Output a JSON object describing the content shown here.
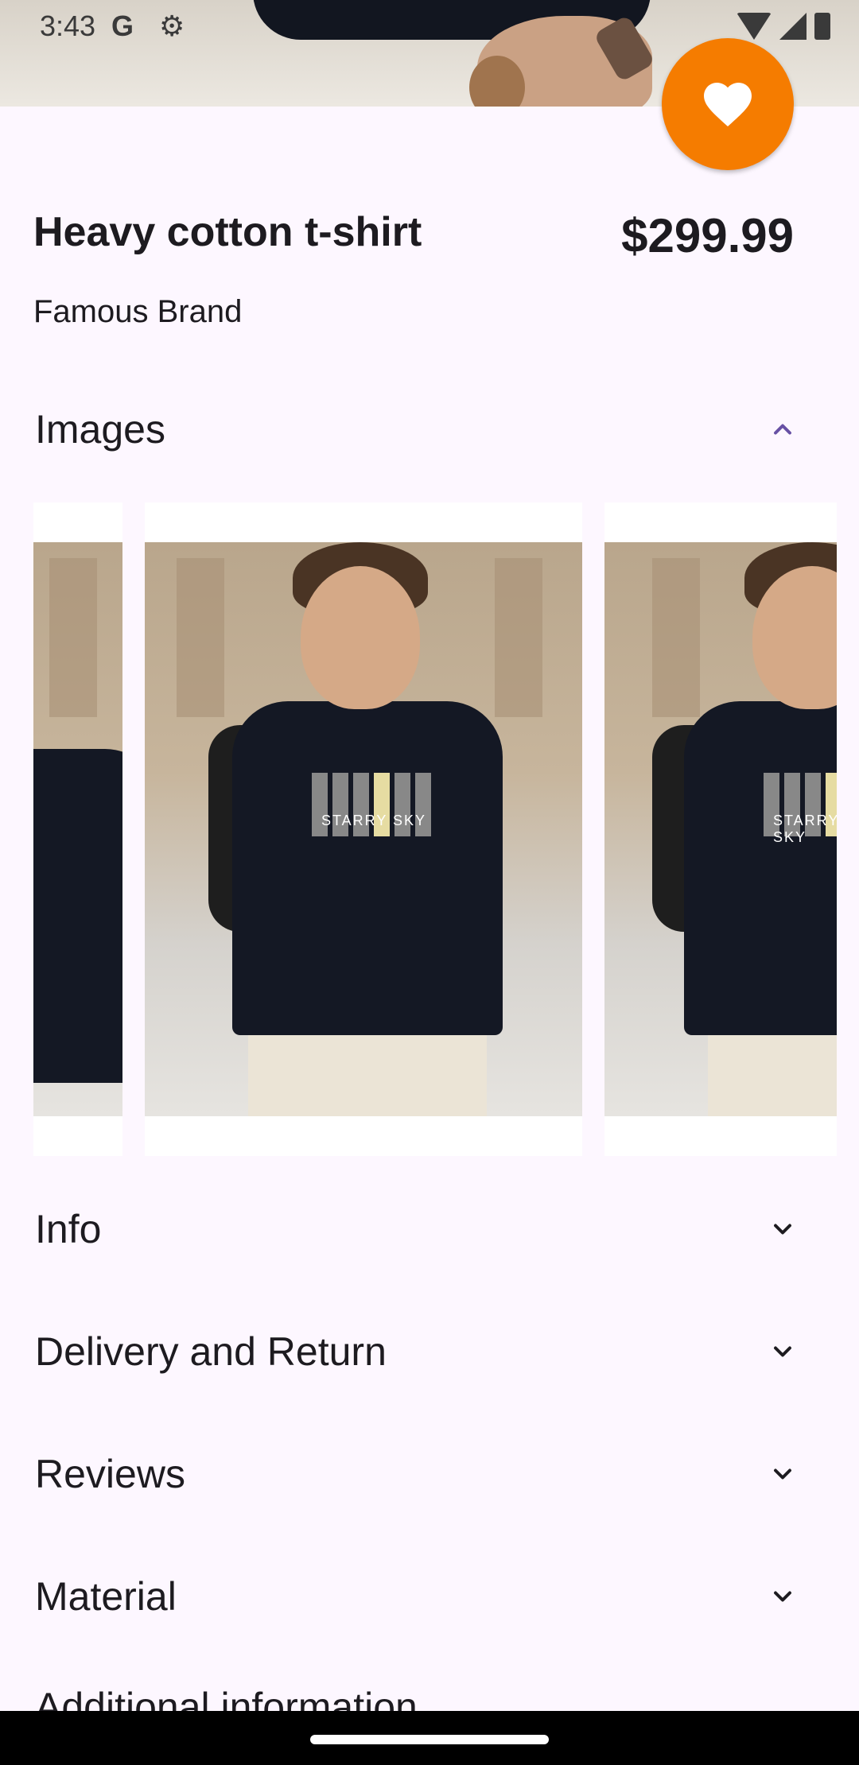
{
  "status_bar": {
    "time": "3:43",
    "g_label": "G",
    "icons": [
      "google-icon",
      "settings-gear-icon",
      "wifi-icon",
      "signal-icon",
      "battery-icon"
    ]
  },
  "product": {
    "title": "Heavy cotton t-shirt",
    "price": "$299.99",
    "brand": "Famous Brand"
  },
  "favorite_button": {
    "icon": "heart-icon",
    "color": "#f57c00"
  },
  "sections": [
    {
      "label": "Images",
      "expanded": true,
      "icon": "chevron-up-icon"
    },
    {
      "label": "Info",
      "expanded": false,
      "icon": "chevron-down-icon"
    },
    {
      "label": "Delivery and Return",
      "expanded": false,
      "icon": "chevron-down-icon"
    },
    {
      "label": "Reviews",
      "expanded": false,
      "icon": "chevron-down-icon"
    },
    {
      "label": "Material",
      "expanded": false,
      "icon": "chevron-down-icon"
    },
    {
      "label": "Additional information",
      "expanded": false,
      "icon": "chevron-down-icon"
    }
  ],
  "carousel": {
    "images": [
      {
        "print_text": "STARRY SKY"
      },
      {
        "print_text": "STARRY SKY"
      },
      {
        "print_text": "STARRY SKY"
      }
    ]
  },
  "colors": {
    "background": "#fdf7ff",
    "accent": "#6750a4",
    "fab": "#f57c00"
  }
}
